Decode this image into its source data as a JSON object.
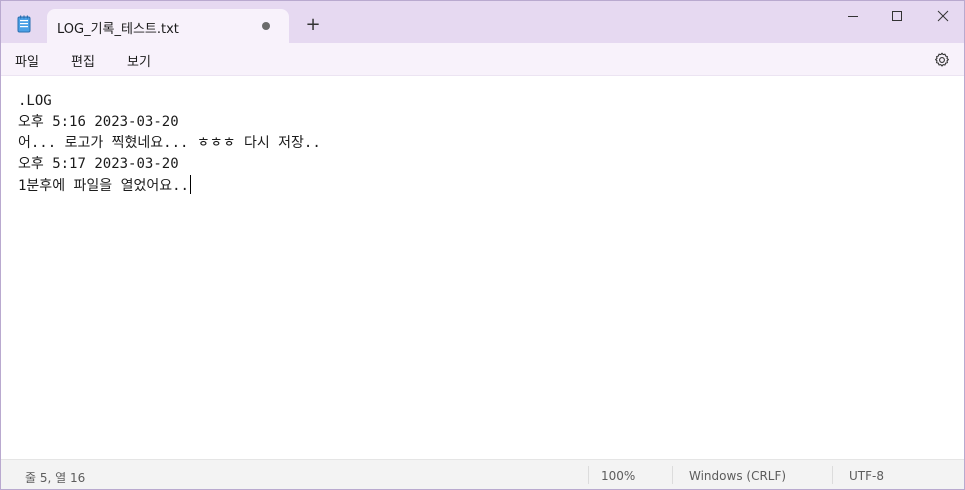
{
  "tab": {
    "title": "LOG_기록_테스트.txt",
    "new_tab_symbol": "+"
  },
  "icons": {
    "app": "notepad-icon",
    "unsaved": "unsaved-dot-icon",
    "minimize": "minimize-icon",
    "maximize": "maximize-icon",
    "close": "close-icon",
    "settings": "gear-icon"
  },
  "menu": {
    "file": "파일",
    "edit": "편집",
    "view": "보기"
  },
  "editor": {
    "lines": [
      ".LOG",
      "오후 5:16 2023-03-20",
      "어... 로고가 찍혔네요... ㅎㅎㅎ 다시 저장..",
      "오후 5:17 2023-03-20",
      "1분후에 파일을 열었어요.."
    ]
  },
  "status": {
    "position": "줄 5, 열 16",
    "zoom": "100%",
    "line_ending": "Windows (CRLF)",
    "encoding": "UTF-8"
  },
  "colors": {
    "titlebar": "#e6d9f1",
    "tab": "#f8f2fb",
    "statusbar": "#f3f3f3"
  }
}
